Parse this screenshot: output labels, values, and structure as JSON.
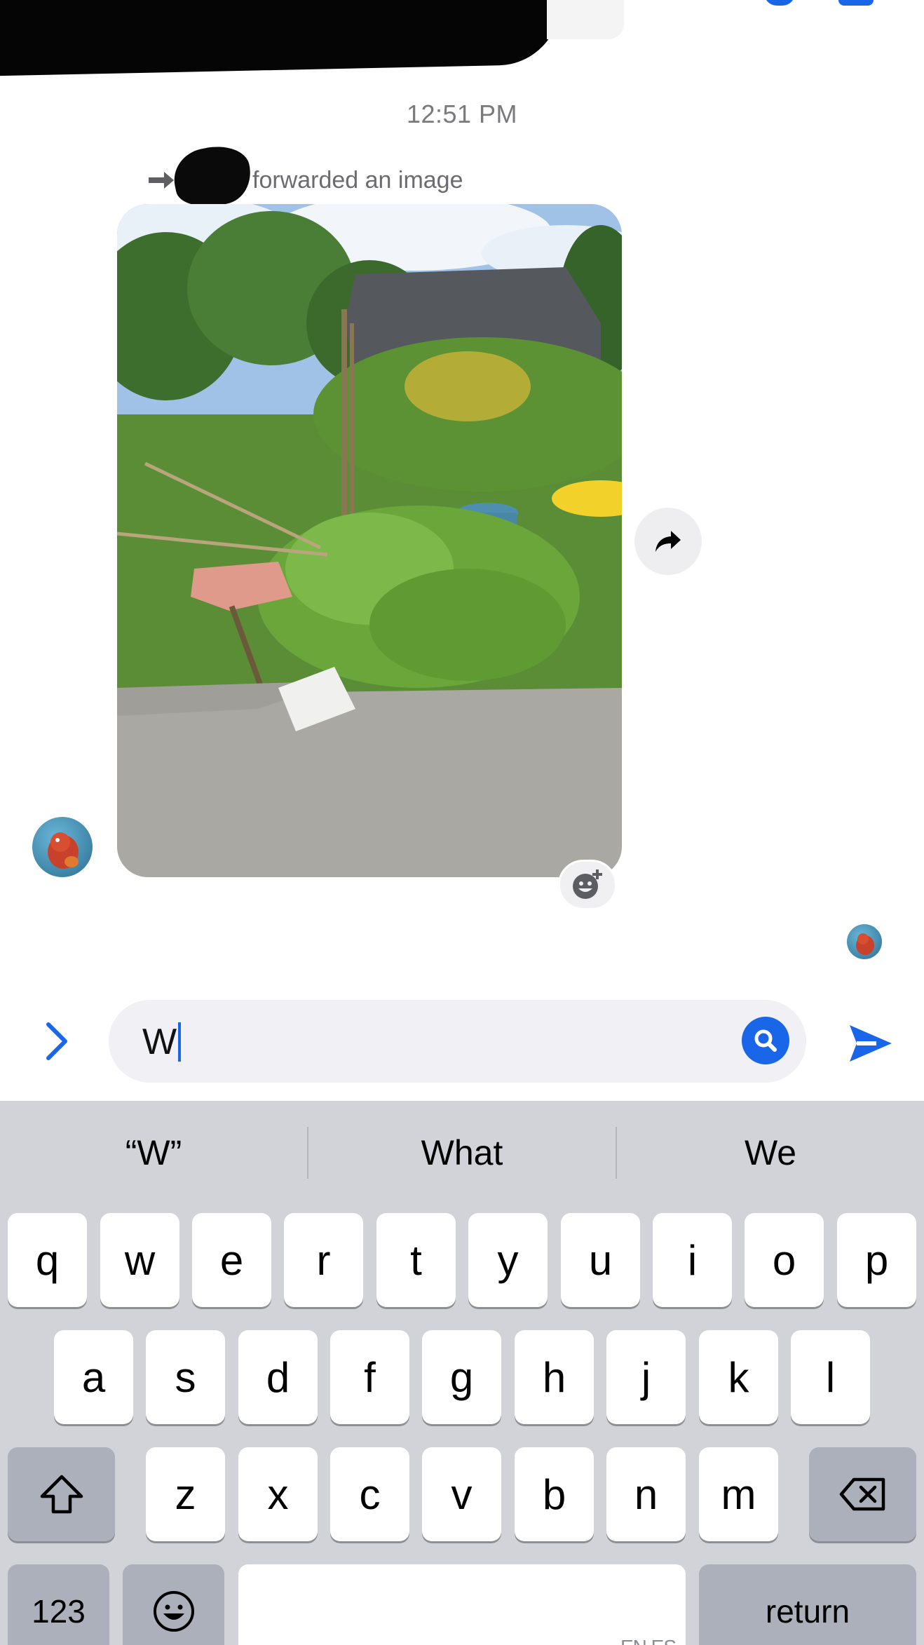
{
  "thread": {
    "timestamp": "12:51 PM",
    "forwarded_label": "forwarded an image",
    "image_description_icon": "photo-garden"
  },
  "icons": {
    "forward_arrow": "forward-arrow-icon",
    "share": "share-icon",
    "add_reaction": "add-reaction-icon",
    "expand": "chevron-right-icon",
    "search": "search-icon",
    "send": "send-icon",
    "shift": "shift-icon",
    "backspace": "backspace-icon",
    "emoji": "emoji-icon"
  },
  "composer": {
    "text": "W"
  },
  "keyboard": {
    "suggestions": [
      "“W”",
      "What",
      "We"
    ],
    "row1": [
      "q",
      "w",
      "e",
      "r",
      "t",
      "y",
      "u",
      "i",
      "o",
      "p"
    ],
    "row2": [
      "a",
      "s",
      "d",
      "f",
      "g",
      "h",
      "j",
      "k",
      "l"
    ],
    "row3": [
      "z",
      "x",
      "c",
      "v",
      "b",
      "n",
      "m"
    ],
    "numbers_key": "123",
    "return_key": "return",
    "space_lang_hint": "EN ES"
  },
  "colors": {
    "accent": "#1a66e8",
    "keyboard_bg": "#d1d3d9",
    "input_bg": "#f0f0f5",
    "timestamp_gray": "#7a7a7e"
  }
}
